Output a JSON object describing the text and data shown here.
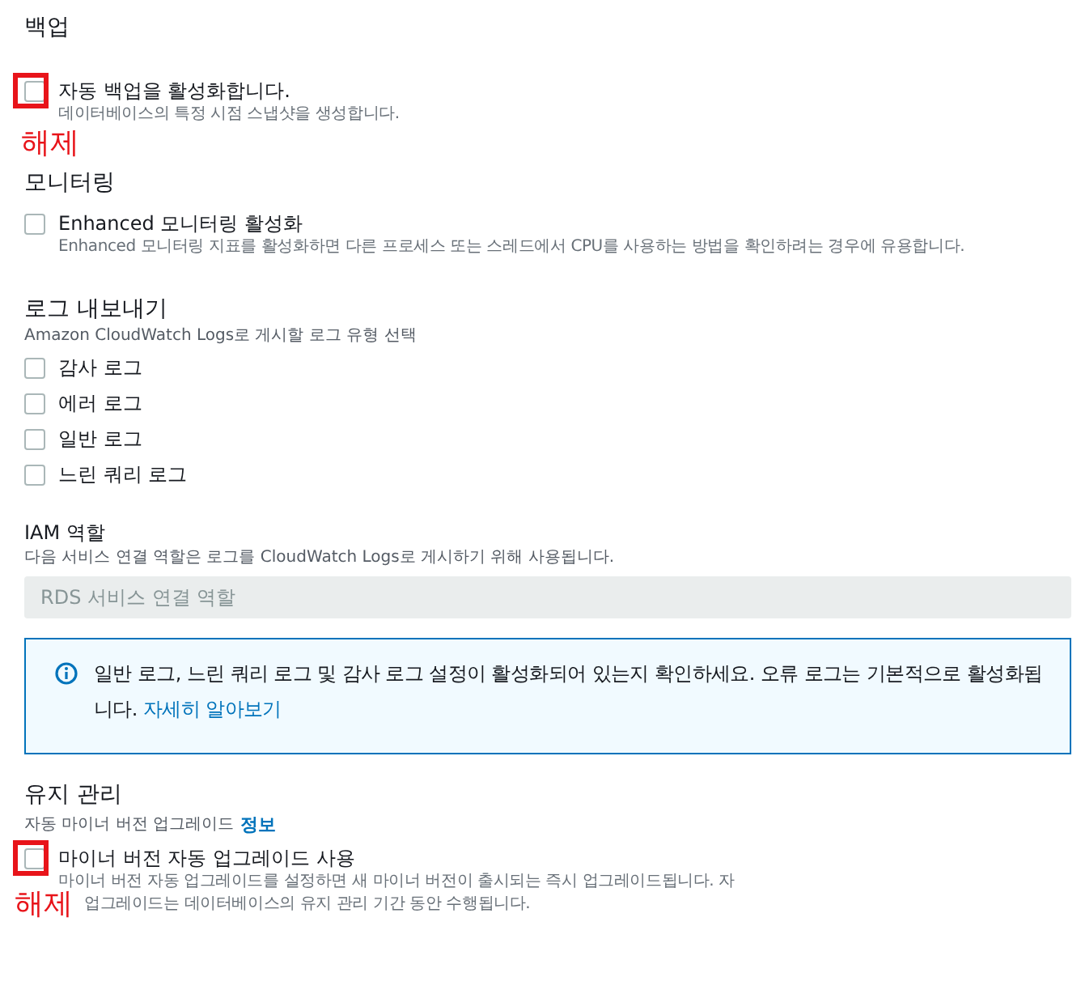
{
  "backup": {
    "heading": "백업",
    "option": {
      "label": "자동 백업을 활성화합니다.",
      "description": "데이터베이스의 특정 시점 스냅샷을 생성합니다.",
      "checked": false
    },
    "annotation": "해제"
  },
  "monitoring": {
    "heading": "모니터링",
    "option": {
      "label": "Enhanced 모니터링 활성화",
      "description": "Enhanced 모니터링 지표를 활성화하면 다른 프로세스 또는 스레드에서 CPU를 사용하는 방법을 확인하려는 경우에 유용합니다.",
      "checked": false
    }
  },
  "log_export": {
    "heading": "로그 내보내기",
    "subtitle": "Amazon CloudWatch Logs로 게시할 로그 유형 선택",
    "options": [
      {
        "label": "감사 로그",
        "checked": false
      },
      {
        "label": "에러 로그",
        "checked": false
      },
      {
        "label": "일반 로그",
        "checked": false
      },
      {
        "label": "느린 쿼리 로그",
        "checked": false
      }
    ]
  },
  "iam_role": {
    "label": "IAM 역할",
    "description": "다음 서비스 연결 역할은 로그를 CloudWatch Logs로 게시하기 위해 사용됩니다.",
    "value": "RDS 서비스 연결 역할"
  },
  "info_alert": {
    "text": "일반 로그, 느린 쿼리 로그 및 감사 로그 설정이 활성화되어 있는지 확인하세요. 오류 로그는 기본적으로 활성화됩니다.",
    "link": "자세히 알아보기"
  },
  "maintenance": {
    "heading": "유지 관리",
    "subtitle": "자동 마이너 버전 업그레이드",
    "info_link": "정보",
    "option": {
      "label": "마이너 버전 자동 업그레이드 사용",
      "description_lines": [
        "마이너 버전 자동 업그레이드를 설정하면 새 마이너 버전이 출시되는 즉시 업그레이드됩니다. 자",
        "업그레이드는 데이터베이스의 유지 관리 기간 동안 수행됩니다."
      ],
      "checked": false
    },
    "annotation": "해제"
  }
}
